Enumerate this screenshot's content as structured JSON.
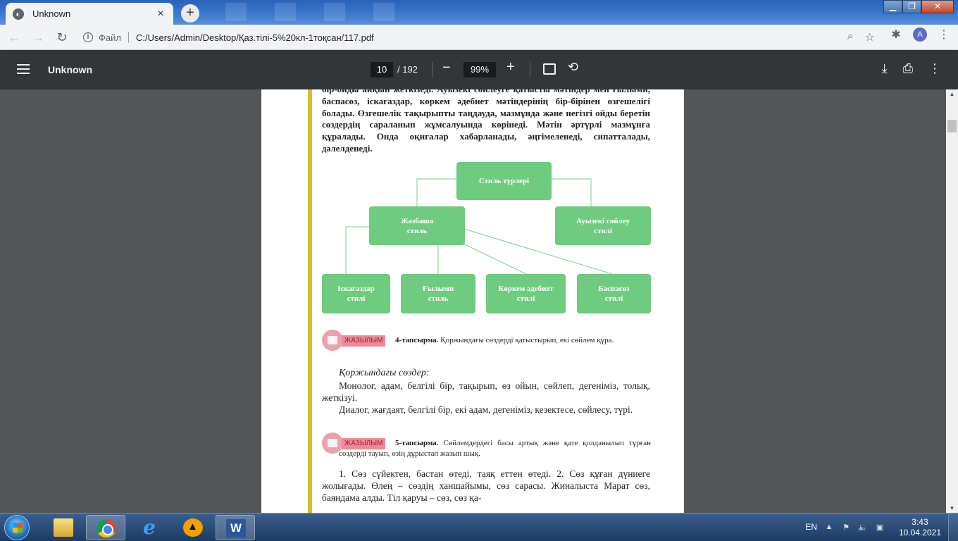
{
  "browser": {
    "tab_title": "Unknown",
    "new_tab_symbol": "+",
    "scheme_label": "Файл",
    "url": "C:/Users/Admin/Desktop/Қаз.тілі-5%20кл-1тоқсан/117.pdf",
    "profile_initial": "A"
  },
  "pdf_toolbar": {
    "title": "Unknown",
    "current_page": "10",
    "total_pages": "/ 192",
    "zoom": "99%"
  },
  "document": {
    "intro_paragraph": "бір-ойды айқын жеткізеді. Ауызекі сөйлеуге қатысты мәтіндер мен ғылыми, баспасөз, іскағаздар, көркем әдебиет мәтіндерінің бір-бірінен өзгешелігі болады. Өзгешелік тақырыпты таңдауда, мазмұнда және негізгі ойды беретін сөздердің сараланып жұмсалуында көрінеді. Мәтін әртүрлі мазмұнға құралады. Онда оқиғалар хабарланады, әңгімеленеді, сипатталады, дәлелденеді.",
    "diagram": {
      "root": "Стиль түрлері",
      "written": [
        "Жазбаша",
        "стиль"
      ],
      "spoken": [
        "Ауызекі сөйлеу",
        "стилі"
      ],
      "leaves": [
        [
          "Іскағаздар",
          "стилі"
        ],
        [
          "Ғылыми",
          "стиль"
        ],
        [
          "Көркем әдебиет",
          "стилі"
        ],
        [
          "Баспасөз",
          "стилі"
        ]
      ]
    },
    "task4": {
      "badge": "ЖАЗЫЛЫМ",
      "number": "4-тапсырма.",
      "text": "Қоржындағы сөздерді қатыстырып, екі сөйлем құра."
    },
    "korzhyn_heading": "Қоржындағы сөздер:",
    "korzhyn_line1": "Монолог, адам,  белгілі бір, тақырып, өз ойын,  сөйлеп, дегеніміз, толық, жеткізуі.",
    "korzhyn_line2": "Диалог, жағдаят, белгілі бір, екі адам, дегеніміз, кезектесе, сөйлесу, түрі.",
    "task5": {
      "badge": "ЖАЗЫЛЫМ",
      "number": "5-тапсырма.",
      "text": "Сөйлемдердегі басы артық және қате қолданылып тұрған сөздерді тауып, өзің дұрыстап жазып шық."
    },
    "final_paragraph": "1. Сөз сүйектен, бастан өтеді, таяқ еттен өтеді. 2. Сөз құған дүниеге жолығады. Өлең – сөздің ханшайымы, сөз сарасы. Жиналыста Марат сөз, баяндама алды. Тіл қаруы – сөз, сөз қа-"
  },
  "taskbar": {
    "language": "EN",
    "time": "3:43",
    "date": "10.04.2021",
    "word_label": "W"
  }
}
